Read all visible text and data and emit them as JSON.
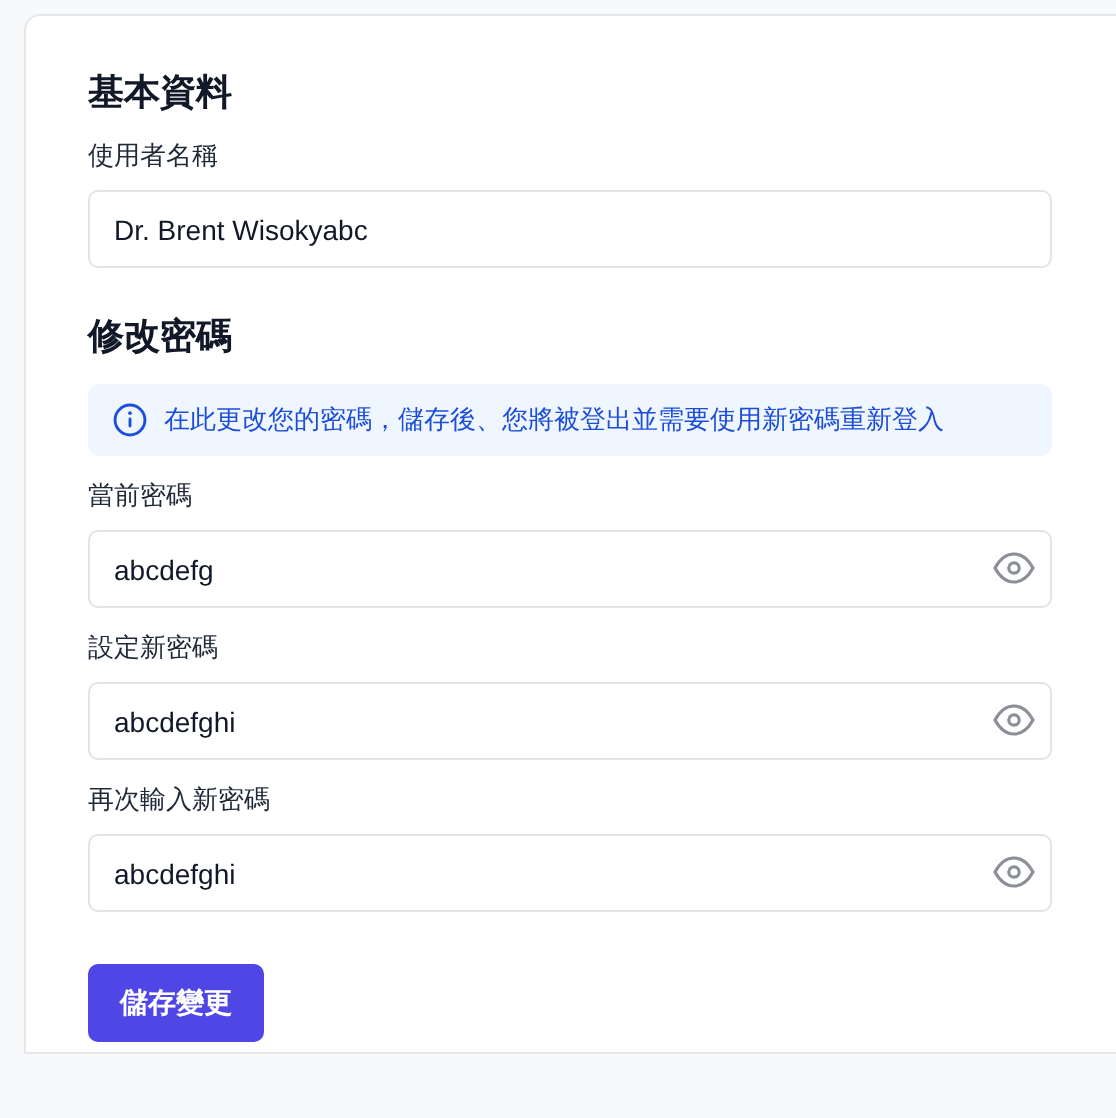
{
  "basic_info": {
    "heading": "基本資料",
    "username": {
      "label": "使用者名稱",
      "value": "Dr. Brent Wisokyabc"
    }
  },
  "change_password": {
    "heading": "修改密碼",
    "notice": "在此更改您的密碼，儲存後、您將被登出並需要使用新密碼重新登入",
    "fields": [
      {
        "label": "當前密碼",
        "value": "abcdefg"
      },
      {
        "label": "設定新密碼",
        "value": "abcdefghi"
      },
      {
        "label": "再次輸入新密碼",
        "value": "abcdefghi"
      }
    ]
  },
  "save_button": "儲存變更"
}
